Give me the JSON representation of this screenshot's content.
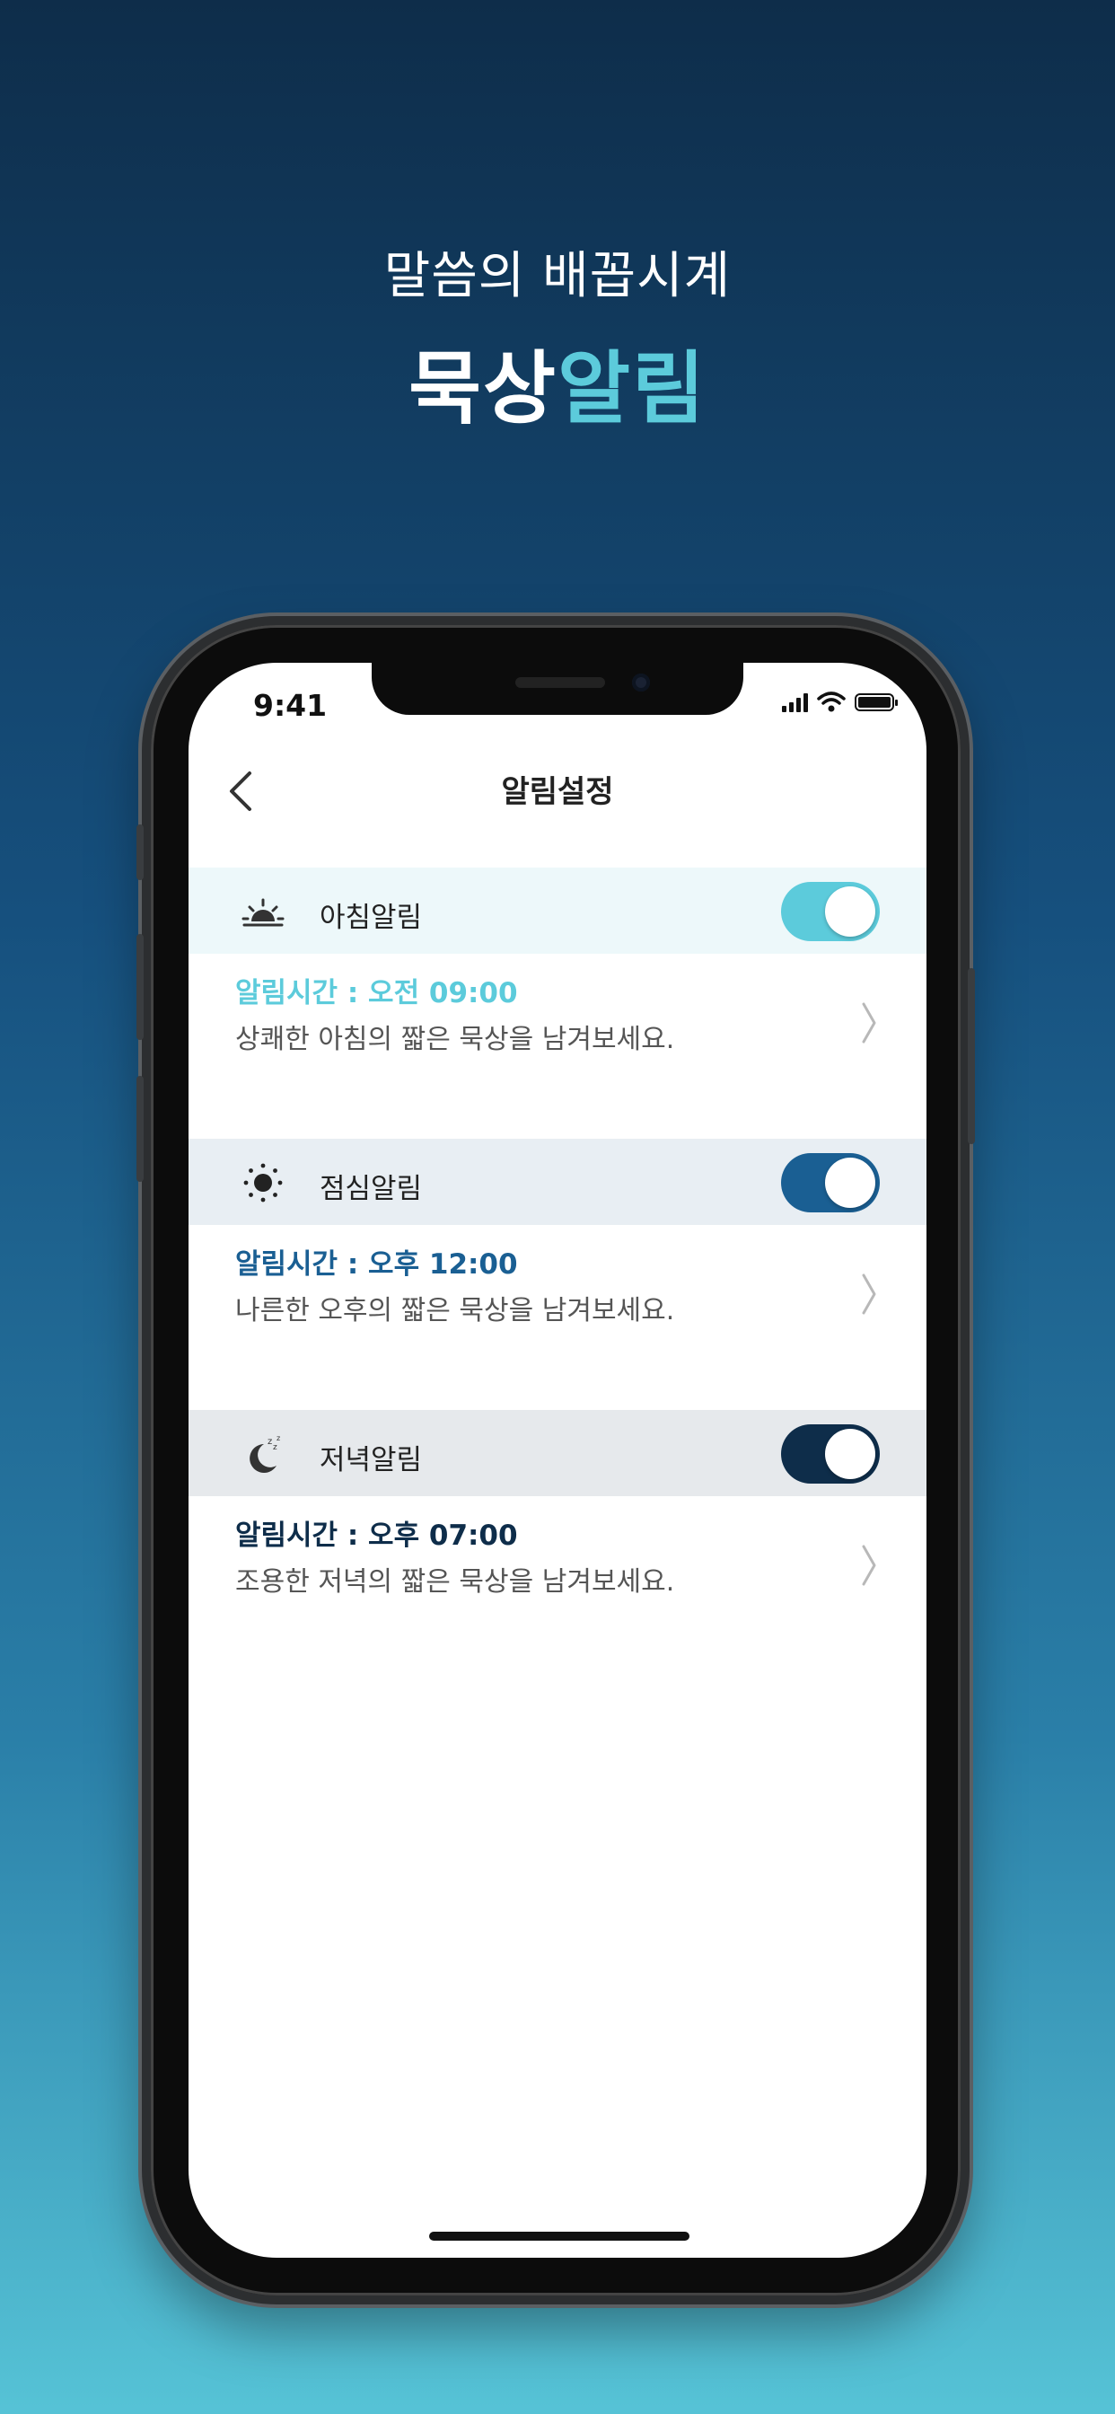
{
  "promo": {
    "subtitle": "말씀의 배꼽시계",
    "title_part1": "묵상",
    "title_part2": "알림"
  },
  "status_bar": {
    "time": "9:41"
  },
  "nav": {
    "title": "알림설정"
  },
  "alarms": [
    {
      "name": "아침알림",
      "icon": "sunrise-icon",
      "enabled": true,
      "time_text": "알림시간 : 오전 09:00",
      "description": "상쾌한 아침의 짧은 묵상을 남겨보세요.",
      "accent": "#5ccbdb",
      "header_bg": "#edf8fa"
    },
    {
      "name": "점심알림",
      "icon": "sun-icon",
      "enabled": true,
      "time_text": "알림시간 : 오후 12:00",
      "description": "나른한 오후의 짧은 묵상을 남겨보세요.",
      "accent": "#1a5f93",
      "header_bg": "#e8eef3"
    },
    {
      "name": "저녁알림",
      "icon": "moon-sleep-icon",
      "enabled": true,
      "time_text": "알림시간 : 오후 07:00",
      "description": "조용한 저녁의 짧은 묵상을 남겨보세요.",
      "accent": "#0e2d4a",
      "header_bg": "#e6e9ec"
    }
  ]
}
